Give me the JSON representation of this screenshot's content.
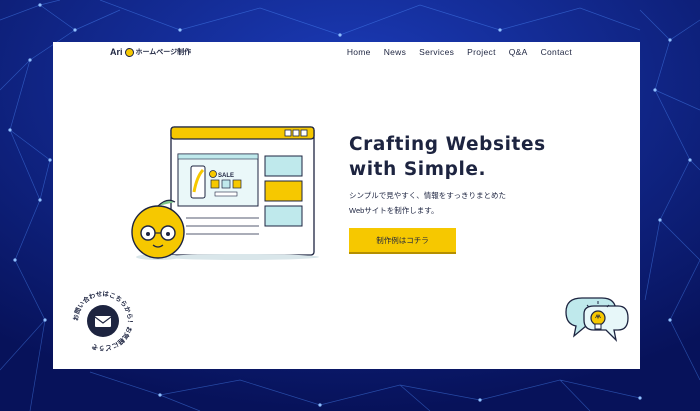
{
  "site": {
    "logo_text": "Ari",
    "logo_sub": "ホームページ制作"
  },
  "nav": {
    "items": [
      "Home",
      "News",
      "Services",
      "Project",
      "Q&A",
      "Contact"
    ]
  },
  "hero": {
    "headline_line1": "Crafting Websites",
    "headline_line2": "with Simple.",
    "sub_line1": "シンプルで見やすく、情報をすっきりまとめた",
    "sub_line2": "Webサイトを制作します。",
    "cta_label": "制作例はコチラ",
    "illustration_badge": "SALE"
  },
  "contact_badge": {
    "ring_text": "お問い合わせはこちらから！お気軽にどうぞ"
  },
  "colors": {
    "background": "#0b1a6e",
    "accent_yellow": "#f6c800",
    "text_navy": "#1d2440",
    "panel_teal": "#bfe9ec"
  },
  "icons": [
    "mail-icon",
    "chat-bubble-icon",
    "lightbulb-icon",
    "orange-mascot-icon",
    "browser-window-icon"
  ]
}
